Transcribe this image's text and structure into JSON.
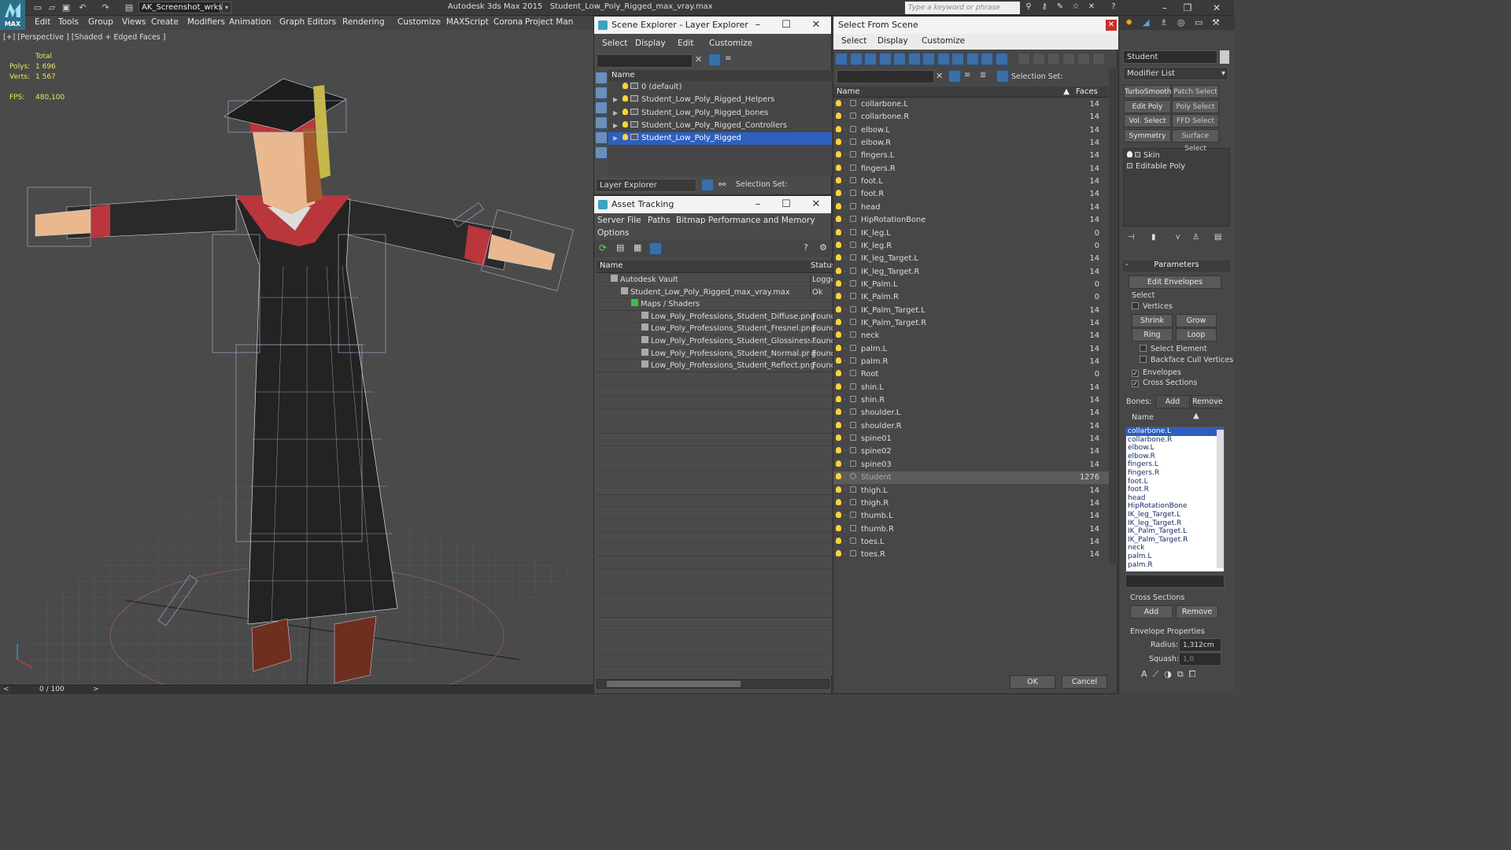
{
  "app": {
    "title": "Autodesk 3ds Max  2015",
    "file": "Student_Low_Poly_Rigged_max_vray.max",
    "workspace": "AK_Screenshot_wrksp",
    "logo_label": "MAX",
    "search_placeholder": "Type a keyword or phrase"
  },
  "menubar": [
    "Edit",
    "Tools",
    "Group",
    "Views",
    "Create",
    "Modifiers",
    "Animation",
    "Graph Editors",
    "Rendering",
    "Customize",
    "MAXScript",
    "Corona",
    "Project Man"
  ],
  "viewport": {
    "label": "[+] [Perspective ] [Shaded + Edged Faces ]",
    "stats": {
      "total": "Total",
      "polys_label": "Polys:",
      "polys": "1 696",
      "verts_label": "Verts:",
      "verts": "1 567",
      "fps_label": "FPS:",
      "fps": "480,100"
    }
  },
  "timeline": {
    "value": "0 / 100"
  },
  "scene_explorer": {
    "title": "Scene Explorer - Layer Explorer",
    "menu": [
      "Select",
      "Display",
      "Edit",
      "Customize"
    ],
    "col_name": "Name",
    "layers": [
      {
        "name": "0 (default)",
        "selected": false,
        "expand": false
      },
      {
        "name": "Student_Low_Poly_Rigged_Helpers",
        "selected": false,
        "expand": true
      },
      {
        "name": "Student_Low_Poly_Rigged_bones",
        "selected": false,
        "expand": true
      },
      {
        "name": "Student_Low_Poly_Rigged_Controllers",
        "selected": false,
        "expand": true
      },
      {
        "name": "Student_Low_Poly_Rigged",
        "selected": true,
        "expand": true
      }
    ],
    "footer_dropdown": "Layer Explorer",
    "selection_set": "Selection Set:"
  },
  "asset_tracking": {
    "title": "Asset Tracking",
    "menu": [
      "Server",
      "File",
      "Paths",
      "Bitmap Performance and Memory",
      "Options"
    ],
    "col_name": "Name",
    "col_status": "Status",
    "rows": [
      {
        "name": "Autodesk Vault",
        "status": "Logge",
        "indent": 0
      },
      {
        "name": "Student_Low_Poly_Rigged_max_vray.max",
        "status": "Ok",
        "indent": 1
      },
      {
        "name": "Maps / Shaders",
        "status": "",
        "indent": 2
      },
      {
        "name": "Low_Poly_Professions_Student_Diffuse.png",
        "status": "Found",
        "indent": 3
      },
      {
        "name": "Low_Poly_Professions_Student_Fresnel.png",
        "status": "Found",
        "indent": 3
      },
      {
        "name": "Low_Poly_Professions_Student_Glossiness....",
        "status": "Found",
        "indent": 3
      },
      {
        "name": "Low_Poly_Professions_Student_Normal.png",
        "status": "Found",
        "indent": 3
      },
      {
        "name": "Low_Poly_Professions_Student_Reflect.png",
        "status": "Found",
        "indent": 3
      }
    ]
  },
  "select_from_scene": {
    "title": "Select From Scene",
    "menu": [
      "Select",
      "Display",
      "Customize"
    ],
    "selection_set": "Selection Set:",
    "col_name": "Name",
    "col_faces": "Faces",
    "ok": "OK",
    "cancel": "Cancel",
    "objects": [
      {
        "name": "collarbone.L",
        "faces": "14"
      },
      {
        "name": "collarbone.R",
        "faces": "14"
      },
      {
        "name": "elbow.L",
        "faces": "14"
      },
      {
        "name": "elbow.R",
        "faces": "14"
      },
      {
        "name": "fingers.L",
        "faces": "14"
      },
      {
        "name": "fingers.R",
        "faces": "14"
      },
      {
        "name": "foot.L",
        "faces": "14"
      },
      {
        "name": "foot.R",
        "faces": "14"
      },
      {
        "name": "head",
        "faces": "14"
      },
      {
        "name": "HipRotationBone",
        "faces": "14"
      },
      {
        "name": "IK_leg.L",
        "faces": "0"
      },
      {
        "name": "IK_leg.R",
        "faces": "0"
      },
      {
        "name": "IK_leg_Target.L",
        "faces": "14"
      },
      {
        "name": "IK_leg_Target.R",
        "faces": "14"
      },
      {
        "name": "IK_Palm.L",
        "faces": "0"
      },
      {
        "name": "IK_Palm.R",
        "faces": "0"
      },
      {
        "name": "IK_Palm_Target.L",
        "faces": "14"
      },
      {
        "name": "IK_Palm_Target.R",
        "faces": "14"
      },
      {
        "name": "neck",
        "faces": "14"
      },
      {
        "name": "palm.L",
        "faces": "14"
      },
      {
        "name": "palm.R",
        "faces": "14"
      },
      {
        "name": "Root",
        "faces": "0"
      },
      {
        "name": "shin.L",
        "faces": "14"
      },
      {
        "name": "shin.R",
        "faces": "14"
      },
      {
        "name": "shoulder.L",
        "faces": "14"
      },
      {
        "name": "shoulder.R",
        "faces": "14"
      },
      {
        "name": "spine01",
        "faces": "14"
      },
      {
        "name": "spine02",
        "faces": "14"
      },
      {
        "name": "spine03",
        "faces": "14"
      },
      {
        "name": "Student",
        "faces": "1276"
      },
      {
        "name": "thigh.L",
        "faces": "14"
      },
      {
        "name": "thigh.R",
        "faces": "14"
      },
      {
        "name": "thumb.L",
        "faces": "14"
      },
      {
        "name": "thumb.R",
        "faces": "14"
      },
      {
        "name": "toes.L",
        "faces": "14"
      },
      {
        "name": "toes.R",
        "faces": "14"
      }
    ]
  },
  "command_panel": {
    "object_name": "Student",
    "modifier_list": "Modifier List",
    "mod_buttons": [
      "TurboSmooth",
      "Patch Select",
      "Edit Poly",
      "Poly Select",
      "Vol. Select",
      "FFD Select",
      "Symmetry",
      "Surface Select"
    ],
    "stack": [
      "Skin",
      "Editable Poly"
    ],
    "parameters": "Parameters",
    "edit_envelopes": "Edit Envelopes",
    "select_group": "Select",
    "vertices": "Vertices",
    "shrink": "Shrink",
    "grow": "Grow",
    "ring": "Ring",
    "loop": "Loop",
    "select_element": "Select Element",
    "backface_cull": "Backface Cull Vertices",
    "envelopes": "Envelopes",
    "cross_sections": "Cross Sections",
    "bones_label": "Bones:",
    "add": "Add",
    "remove": "Remove",
    "name_col": "Name",
    "bones": [
      "collarbone.L",
      "collarbone.R",
      "elbow.L",
      "elbow.R",
      "fingers.L",
      "fingers.R",
      "foot.L",
      "foot.R",
      "head",
      "HipRotationBone",
      "IK_leg_Target.L",
      "IK_leg_Target.R",
      "IK_Palm_Target.L",
      "IK_Palm_Target.R",
      "neck",
      "palm.L",
      "palm.R"
    ],
    "cross_sections_group": "Cross Sections",
    "cs_add": "Add",
    "cs_remove": "Remove",
    "envelope_props": "Envelope Properties",
    "radius_label": "Radius:",
    "radius": "1,312cm",
    "squash_label": "Squash:",
    "squash": "1,0"
  },
  "colors": {
    "accent": "#2c5fbf",
    "bulb": "#ffd23a",
    "stats": "#e8e85a",
    "gown": "#222222",
    "trim": "#b8363c"
  }
}
